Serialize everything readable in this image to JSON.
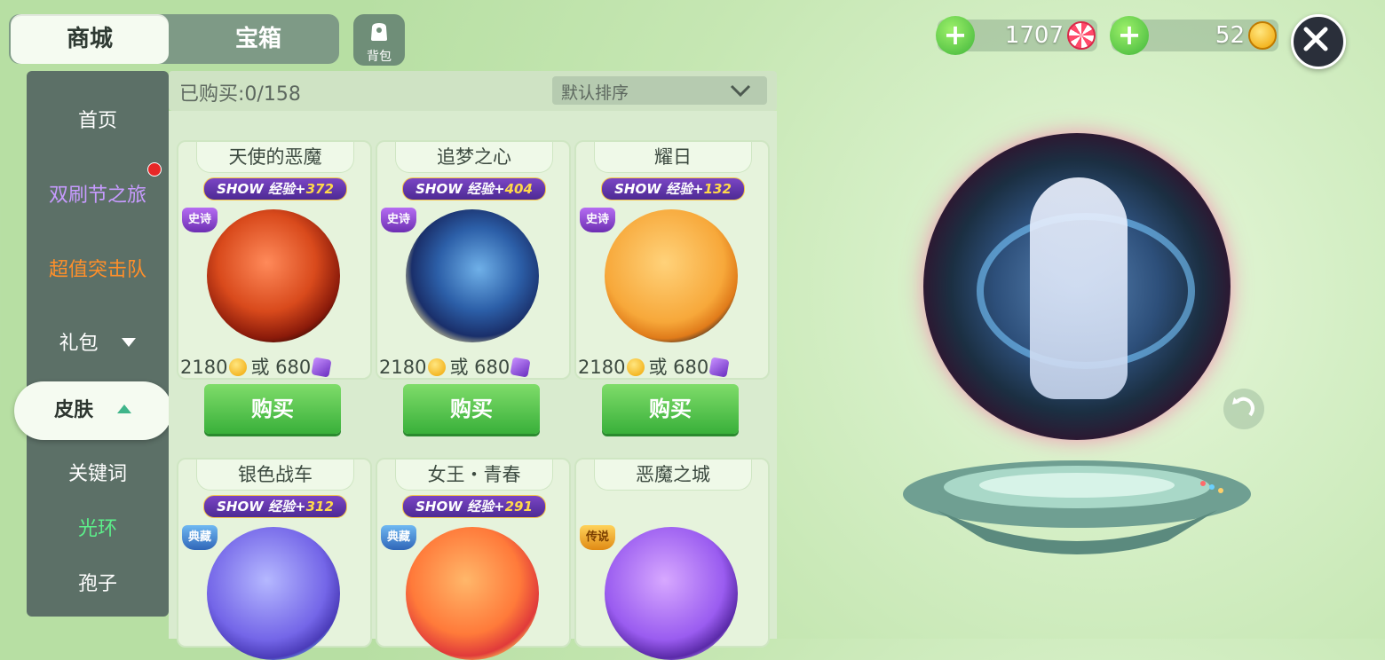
{
  "tabs": [
    {
      "label": "商城",
      "active": true
    },
    {
      "label": "宝箱",
      "active": false
    }
  ],
  "bag": {
    "label": "背包",
    "icon": "bag-icon"
  },
  "nav": {
    "items": [
      {
        "label": "首页",
        "color": "#ffffff"
      },
      {
        "label": "双刷节之旅",
        "color": "#c79bff",
        "has_dot": true
      },
      {
        "label": "超值突击队",
        "color": "#ff8f2a"
      },
      {
        "label": "礼包",
        "color": "#ffffff",
        "arrow": "down"
      },
      {
        "label": "皮肤",
        "selected": true,
        "arrow": "up"
      },
      {
        "label": "关键词",
        "color": "#ffffff"
      },
      {
        "label": "光环",
        "color": "#5cf08a"
      },
      {
        "label": "孢子",
        "color": "#ffffff"
      }
    ]
  },
  "filter": {
    "purchased": "已购买:0/158",
    "sort": "默认排序"
  },
  "shop_items": [
    {
      "name": "天使的恶魔",
      "exp": "372",
      "rarity": "史诗",
      "price_coin": "2180",
      "or": "或",
      "price_gem": "680",
      "buy": "购买",
      "orb": "radial-gradient(circle at 45% 40%, #ff8a5a 0, #d94a1c 45%, #8a1a0a 70%, #2a0a05 82%, #ff6a00 86%, #1a1a1a 92%)"
    },
    {
      "name": "追梦之心",
      "exp": "404",
      "rarity": "史诗",
      "price_coin": "2180",
      "or": "或",
      "price_gem": "680",
      "buy": "购买",
      "orb": "radial-gradient(circle at 55% 45%, #6fb0e8 0, #2c5fa8 40%, #1a2f6a 65%, #f4e9a0 80%, #1a1a1a 90%)"
    },
    {
      "name": "耀日",
      "exp": "132",
      "rarity": "史诗",
      "price_coin": "2180",
      "or": "或",
      "price_gem": "680",
      "buy": "购买",
      "orb": "radial-gradient(circle at 45% 40%, #ffd27a 0, #f7a83a 55%, #e07b1a 70%, #2b2a2a 80%, #151515 92%)"
    },
    {
      "name": "银色战车",
      "exp": "312",
      "rarity": "典藏",
      "orb": "radial-gradient(circle at 45% 40%, #b5b8ff 0, #7466e8 55%, #4a3bb8 72%, #7fd0ff 80%, #1a1a2a 92%)"
    },
    {
      "name": "女王・青春",
      "exp": "291",
      "rarity": "典藏",
      "orb": "radial-gradient(circle at 45% 40%, #ffb76a 0, #ff7a3a 50%, #e03a3a 70%, #ffd85a 80%, #1a1a1a 92%)"
    },
    {
      "name": "恶魔之城",
      "exp": "",
      "rarity": "传说",
      "orb": "radial-gradient(circle at 45% 40%, #d7a8ff 0, #9a5cf0 55%, #5a2aa8 72%, #b890ff 80%, #1a1a2a 92%)"
    }
  ],
  "exp_label": {
    "show": "SHOW",
    "exp": "经验",
    "plus": "+"
  },
  "currency": {
    "candy": "1707",
    "coin": "52"
  },
  "colors": {
    "accent": "#3fb53a",
    "nav_bg": "#5c7067",
    "card_bg": "#e6f3dc"
  }
}
